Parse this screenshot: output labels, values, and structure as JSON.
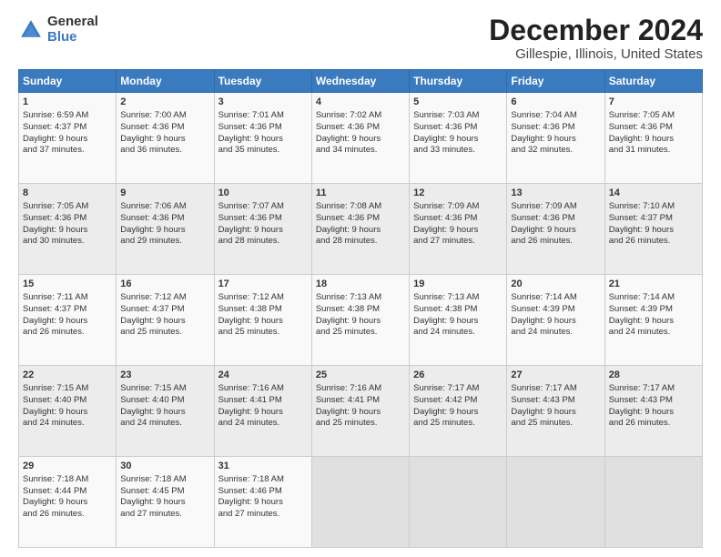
{
  "logo": {
    "general": "General",
    "blue": "Blue"
  },
  "title": "December 2024",
  "subtitle": "Gillespie, Illinois, United States",
  "days_of_week": [
    "Sunday",
    "Monday",
    "Tuesday",
    "Wednesday",
    "Thursday",
    "Friday",
    "Saturday"
  ],
  "weeks": [
    [
      {
        "day": "1",
        "info": "Sunrise: 6:59 AM\nSunset: 4:37 PM\nDaylight: 9 hours\nand 37 minutes."
      },
      {
        "day": "2",
        "info": "Sunrise: 7:00 AM\nSunset: 4:36 PM\nDaylight: 9 hours\nand 36 minutes."
      },
      {
        "day": "3",
        "info": "Sunrise: 7:01 AM\nSunset: 4:36 PM\nDaylight: 9 hours\nand 35 minutes."
      },
      {
        "day": "4",
        "info": "Sunrise: 7:02 AM\nSunset: 4:36 PM\nDaylight: 9 hours\nand 34 minutes."
      },
      {
        "day": "5",
        "info": "Sunrise: 7:03 AM\nSunset: 4:36 PM\nDaylight: 9 hours\nand 33 minutes."
      },
      {
        "day": "6",
        "info": "Sunrise: 7:04 AM\nSunset: 4:36 PM\nDaylight: 9 hours\nand 32 minutes."
      },
      {
        "day": "7",
        "info": "Sunrise: 7:05 AM\nSunset: 4:36 PM\nDaylight: 9 hours\nand 31 minutes."
      }
    ],
    [
      {
        "day": "8",
        "info": "Sunrise: 7:05 AM\nSunset: 4:36 PM\nDaylight: 9 hours\nand 30 minutes."
      },
      {
        "day": "9",
        "info": "Sunrise: 7:06 AM\nSunset: 4:36 PM\nDaylight: 9 hours\nand 29 minutes."
      },
      {
        "day": "10",
        "info": "Sunrise: 7:07 AM\nSunset: 4:36 PM\nDaylight: 9 hours\nand 28 minutes."
      },
      {
        "day": "11",
        "info": "Sunrise: 7:08 AM\nSunset: 4:36 PM\nDaylight: 9 hours\nand 28 minutes."
      },
      {
        "day": "12",
        "info": "Sunrise: 7:09 AM\nSunset: 4:36 PM\nDaylight: 9 hours\nand 27 minutes."
      },
      {
        "day": "13",
        "info": "Sunrise: 7:09 AM\nSunset: 4:36 PM\nDaylight: 9 hours\nand 26 minutes."
      },
      {
        "day": "14",
        "info": "Sunrise: 7:10 AM\nSunset: 4:37 PM\nDaylight: 9 hours\nand 26 minutes."
      }
    ],
    [
      {
        "day": "15",
        "info": "Sunrise: 7:11 AM\nSunset: 4:37 PM\nDaylight: 9 hours\nand 26 minutes."
      },
      {
        "day": "16",
        "info": "Sunrise: 7:12 AM\nSunset: 4:37 PM\nDaylight: 9 hours\nand 25 minutes."
      },
      {
        "day": "17",
        "info": "Sunrise: 7:12 AM\nSunset: 4:38 PM\nDaylight: 9 hours\nand 25 minutes."
      },
      {
        "day": "18",
        "info": "Sunrise: 7:13 AM\nSunset: 4:38 PM\nDaylight: 9 hours\nand 25 minutes."
      },
      {
        "day": "19",
        "info": "Sunrise: 7:13 AM\nSunset: 4:38 PM\nDaylight: 9 hours\nand 24 minutes."
      },
      {
        "day": "20",
        "info": "Sunrise: 7:14 AM\nSunset: 4:39 PM\nDaylight: 9 hours\nand 24 minutes."
      },
      {
        "day": "21",
        "info": "Sunrise: 7:14 AM\nSunset: 4:39 PM\nDaylight: 9 hours\nand 24 minutes."
      }
    ],
    [
      {
        "day": "22",
        "info": "Sunrise: 7:15 AM\nSunset: 4:40 PM\nDaylight: 9 hours\nand 24 minutes."
      },
      {
        "day": "23",
        "info": "Sunrise: 7:15 AM\nSunset: 4:40 PM\nDaylight: 9 hours\nand 24 minutes."
      },
      {
        "day": "24",
        "info": "Sunrise: 7:16 AM\nSunset: 4:41 PM\nDaylight: 9 hours\nand 24 minutes."
      },
      {
        "day": "25",
        "info": "Sunrise: 7:16 AM\nSunset: 4:41 PM\nDaylight: 9 hours\nand 25 minutes."
      },
      {
        "day": "26",
        "info": "Sunrise: 7:17 AM\nSunset: 4:42 PM\nDaylight: 9 hours\nand 25 minutes."
      },
      {
        "day": "27",
        "info": "Sunrise: 7:17 AM\nSunset: 4:43 PM\nDaylight: 9 hours\nand 25 minutes."
      },
      {
        "day": "28",
        "info": "Sunrise: 7:17 AM\nSunset: 4:43 PM\nDaylight: 9 hours\nand 26 minutes."
      }
    ],
    [
      {
        "day": "29",
        "info": "Sunrise: 7:18 AM\nSunset: 4:44 PM\nDaylight: 9 hours\nand 26 minutes."
      },
      {
        "day": "30",
        "info": "Sunrise: 7:18 AM\nSunset: 4:45 PM\nDaylight: 9 hours\nand 27 minutes."
      },
      {
        "day": "31",
        "info": "Sunrise: 7:18 AM\nSunset: 4:46 PM\nDaylight: 9 hours\nand 27 minutes."
      },
      {
        "day": "",
        "info": ""
      },
      {
        "day": "",
        "info": ""
      },
      {
        "day": "",
        "info": ""
      },
      {
        "day": "",
        "info": ""
      }
    ]
  ]
}
